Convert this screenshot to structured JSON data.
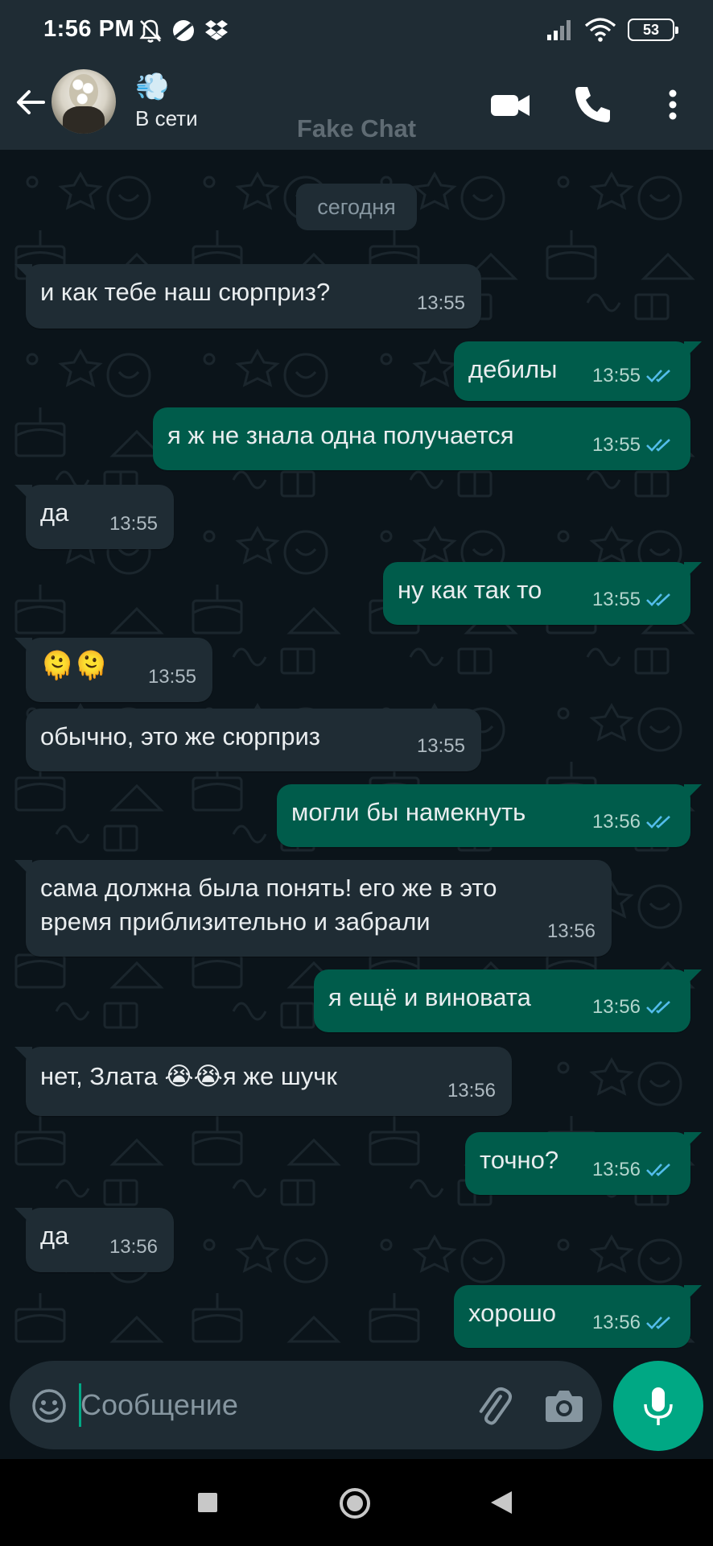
{
  "status_bar": {
    "time": "1:56 PM",
    "battery": "53",
    "icons": [
      "do-not-disturb-icon",
      "data-saver-icon",
      "dropbox-icon",
      "signal-icon",
      "wifi-icon",
      "battery-icon"
    ]
  },
  "header": {
    "contact_name": "💨",
    "contact_status": "В сети",
    "watermark": "Fake Chat",
    "icons": [
      "back-arrow-icon",
      "video-call-icon",
      "phone-call-icon",
      "more-vert-icon"
    ]
  },
  "chat": {
    "date_chip": "сегодня",
    "messages": [
      {
        "dir": "in",
        "text": "и как тебе наш сюрприз?",
        "time": "13:55"
      },
      {
        "dir": "out",
        "text": "дебилы",
        "time": "13:55",
        "read": true
      },
      {
        "dir": "out",
        "text": "я ж не знала одна получается",
        "time": "13:55",
        "read": true
      },
      {
        "dir": "in",
        "text": "да",
        "time": "13:55"
      },
      {
        "dir": "out",
        "text": "ну как так то",
        "time": "13:55",
        "read": true
      },
      {
        "dir": "in",
        "text": "🫠🫠",
        "time": "13:55"
      },
      {
        "dir": "in",
        "text": "обычно, это же сюрприз",
        "time": "13:55"
      },
      {
        "dir": "out",
        "text": "могли бы намекнуть",
        "time": "13:56",
        "read": true
      },
      {
        "dir": "in",
        "text": "сама должна была понять! его же в это\nвремя приблизительно и забрали",
        "time": "13:56"
      },
      {
        "dir": "out",
        "text": "я ещё и виновата",
        "time": "13:56",
        "read": true
      },
      {
        "dir": "in",
        "text": "нет, Злата 😭😭я же шучк",
        "time": "13:56"
      },
      {
        "dir": "out",
        "text": "точно?",
        "time": "13:56",
        "read": true
      },
      {
        "dir": "in",
        "text": "да",
        "time": "13:56"
      },
      {
        "dir": "out",
        "text": "хорошо",
        "time": "13:56",
        "read": true
      }
    ]
  },
  "composer": {
    "placeholder": "Сообщение",
    "icons": [
      "emoji-icon",
      "attach-icon",
      "camera-icon",
      "mic-icon"
    ]
  },
  "colors": {
    "background": "#0b141a",
    "header": "#1f2c34",
    "incoming_bubble": "#1f2c34",
    "outgoing_bubble": "#005c4b",
    "accent": "#00a884",
    "read_tick": "#53bdeb"
  }
}
